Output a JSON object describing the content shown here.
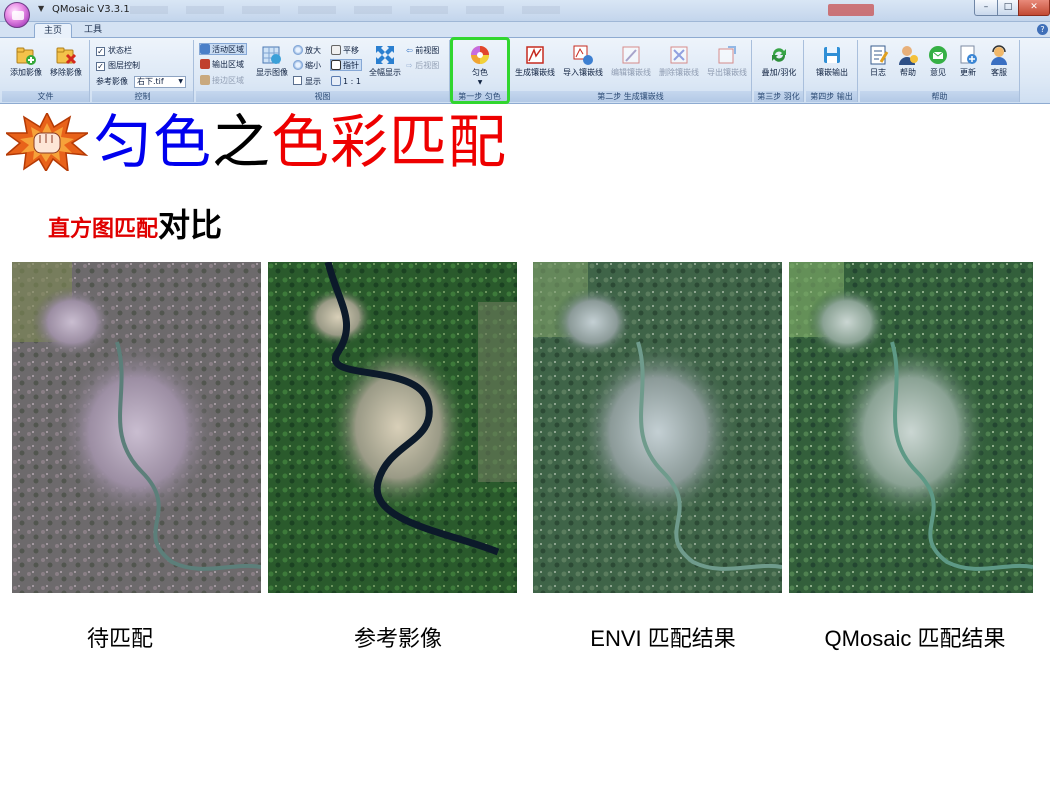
{
  "window": {
    "title": "QMosaic V3.3.1",
    "controls": {
      "minimize": "–",
      "maximize": "□",
      "close": "✕"
    }
  },
  "tabs": [
    {
      "label": "主页",
      "active": true
    },
    {
      "label": "工具",
      "active": false
    }
  ],
  "ribbon": {
    "file": {
      "label": "文件",
      "add_image": "添加影像",
      "remove_image": "移除影像"
    },
    "control": {
      "label": "控制",
      "status_bar": "状态栏",
      "layer_control": "图层控制",
      "reference_label": "参考影像",
      "reference_value": "右下.tif"
    },
    "view": {
      "label": "视图",
      "active_area": "活动区域",
      "output_area": "输出区域",
      "mosaic_area": "接边区域",
      "show_image": "显示图像",
      "zoom_in": "放大",
      "zoom_out": "缩小",
      "show": "显示",
      "pan": "平移",
      "pointer": "指针",
      "one_to_one": "1 : 1",
      "full_view": "全幅显示",
      "prev_view": "前视图",
      "next_view": "后视图"
    },
    "step1": {
      "label": "第一步 匀色",
      "color_balance": "匀色"
    },
    "step2": {
      "label": "第二步 生成镶嵌线",
      "generate_seamline": "生成镶嵌线",
      "import_seamline": "导入镶嵌线",
      "edit_seamline": "编辑镶嵌线",
      "delete_seamline": "删除镶嵌线",
      "export_seamline": "导出镶嵌线"
    },
    "step3": {
      "label": "第三步 羽化",
      "blend": "叠加/羽化"
    },
    "step4": {
      "label": "第四步 输出",
      "mosaic_output": "镶嵌输出"
    },
    "help": {
      "label": "帮助",
      "log": "日志",
      "help": "帮助",
      "feedback": "意见",
      "update": "更新",
      "support": "客服"
    }
  },
  "slide": {
    "title_part1": "匀色",
    "title_part2": "之",
    "title_part3": "色彩匹配",
    "subtitle_red": "直方图匹配",
    "subtitle_black": "对比",
    "captions": [
      "待匹配",
      "参考影像",
      "ENVI 匹配结果",
      "QMosaic 匹配结果"
    ]
  },
  "colors": {
    "title_blue": "#0000ee",
    "title_red": "#ee0000",
    "highlight_green": "#31d62f",
    "ribbon_bg": "#dbe7f5"
  }
}
